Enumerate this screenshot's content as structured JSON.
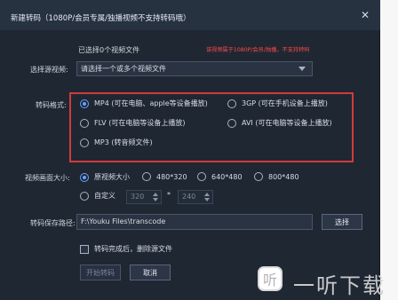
{
  "dialog": {
    "title": "新建转码（1080P/会员专属/独播视频不支持转码哦）",
    "close_glyph": "✕"
  },
  "source": {
    "selected_count_text": "已选择0个视频文件",
    "note": "该视频属于1080P/会员/独播，不支持转码",
    "label": "选择源视频:",
    "select_value": "请选择一个或多个视频文件"
  },
  "format": {
    "label": "转码格式:",
    "options": [
      {
        "text": "MP4 (可在电脑、apple等设备播放)",
        "selected": true
      },
      {
        "text": "3GP (可在手机设备上播放)",
        "selected": false
      },
      {
        "text": "FLV (可在电脑等设备上播放)",
        "selected": false
      },
      {
        "text": "AVI (可在电脑等设备上播放)",
        "selected": false
      },
      {
        "text": "MP3 (转音频文件)",
        "selected": false
      }
    ]
  },
  "size": {
    "label": "视频画面大小:",
    "options": [
      {
        "text": "原视频大小",
        "selected": true
      },
      {
        "text": "480*320",
        "selected": false
      },
      {
        "text": "640*480",
        "selected": false
      },
      {
        "text": "800*480",
        "selected": false
      }
    ],
    "custom_label": "自定义",
    "width_value": "320",
    "multiply": "*",
    "height_value": "240"
  },
  "save": {
    "label": "转码保存路径:",
    "path": "F:\\Youku Files\\transcode",
    "browse_label": "选择"
  },
  "delete_after": {
    "label": "转码完成后，删除源文件"
  },
  "actions": {
    "start_label": "开始转码",
    "cancel_label": "取消"
  },
  "watermark": {
    "icon_text": "听",
    "text": "一听下载"
  },
  "colors": {
    "dialog_bg": "#1f2733",
    "accent": "#6aa2ff",
    "highlight_border": "#d23b3b",
    "warning_text": "#ff4a4a"
  }
}
